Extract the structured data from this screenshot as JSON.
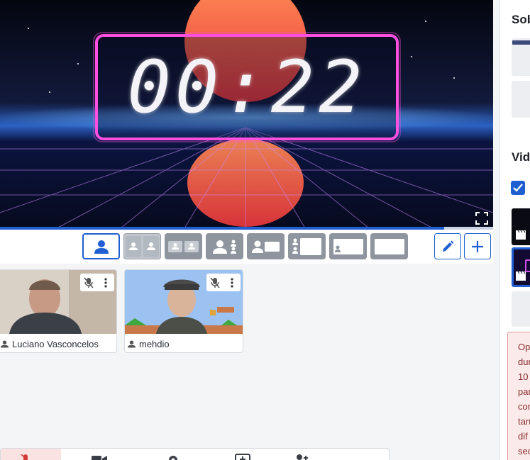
{
  "preview": {
    "timer": "00:22",
    "progress_fraction": 0.9
  },
  "layouts": {
    "options": [
      "solo",
      "side-by-side",
      "grouped",
      "thin-right",
      "picture-right",
      "picture-left",
      "picture-small",
      "blank"
    ]
  },
  "participants": [
    {
      "name": "Luciano Vasconcelos",
      "muted": true
    },
    {
      "name": "mehdio",
      "muted": true
    }
  ],
  "right_panel": {
    "heading_1": "Sob",
    "heading_2": "Vid",
    "warning_lines": [
      "Op",
      "dur",
      "10",
      "par",
      "cor",
      "tan",
      "dif",
      "sec"
    ]
  },
  "colors": {
    "accent": "#1f5fd1",
    "neon": "#ff4fe0",
    "muted_bg": "#8e959f",
    "warning_bg": "#fbeaea"
  }
}
